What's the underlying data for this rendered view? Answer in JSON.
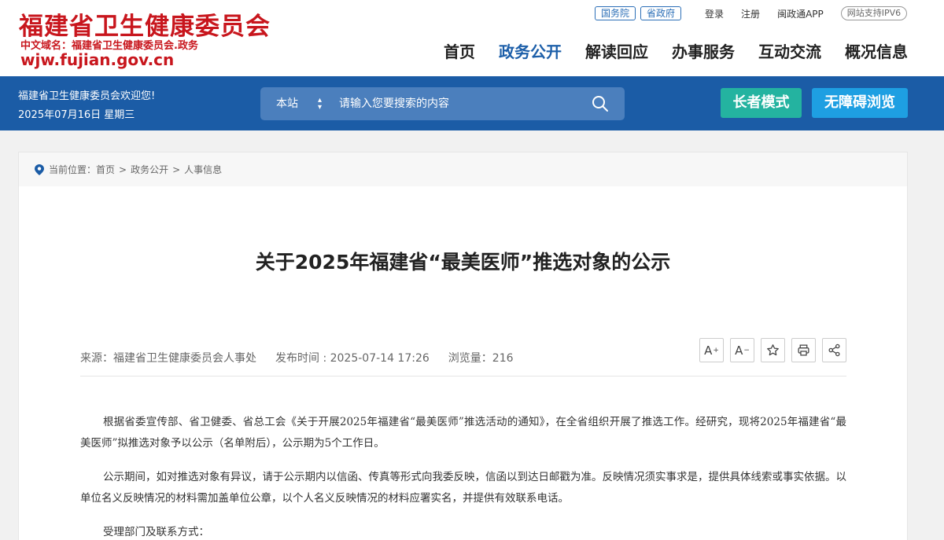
{
  "header": {
    "site_name": "福建省卫生健康委员会",
    "domain_cn": "中文域名：福建省卫生健康委员会.政务",
    "domain_url": "wjw.fujian.gov.cn",
    "top_links": {
      "state_council": "国务院",
      "province_gov": "省政府",
      "login": "登录",
      "register": "注册",
      "app": "闽政通APP",
      "ipv6": "网站支持IPV6"
    },
    "nav": [
      "首页",
      "政务公开",
      "解读回应",
      "办事服务",
      "互动交流",
      "概况信息"
    ],
    "nav_active": "政务公开"
  },
  "bar": {
    "welcome": "福建省卫生健康委员会欢迎您!",
    "date": "2025年07月16日  星期三",
    "search_scope": "本站",
    "search_placeholder": "请输入您要搜索的内容",
    "elder_mode": "长者模式",
    "accessible": "无障碍浏览"
  },
  "breadcrumb": {
    "label": "当前位置：",
    "items": [
      "首页",
      "政务公开",
      "人事信息"
    ]
  },
  "article": {
    "title": "关于2025年福建省“最美医师”推选对象的公示",
    "source": "来源：福建省卫生健康委员会人事处",
    "publish_time": "发布时间 : 2025-07-14 17:26",
    "views": "浏览量：216",
    "tools": {
      "font_up": "A",
      "font_down": "A"
    },
    "paragraphs": [
      "根据省委宣传部、省卫健委、省总工会《关于开展2025年福建省“最美医师”推选活动的通知》，在全省组织开展了推选工作。经研究，现将2025年福建省“最美医师”拟推选对象予以公示（名单附后），公示期为5个工作日。",
      "公示期间，如对推选对象有异议，请于公示期内以信函、传真等形式向我委反映，信函以到达日邮戳为准。反映情况须实事求是，提供具体线索或事实依据。以单位名义反映情况的材料需加盖单位公章，以个人名义反映情况的材料应署实名，并提供有效联系电话。",
      "受理部门及联系方式："
    ]
  },
  "colors": {
    "brand_red": "#c8161d",
    "bar_blue": "#1b5ca6",
    "elder_green": "#24b3a0",
    "access_blue": "#1e9fe2"
  }
}
